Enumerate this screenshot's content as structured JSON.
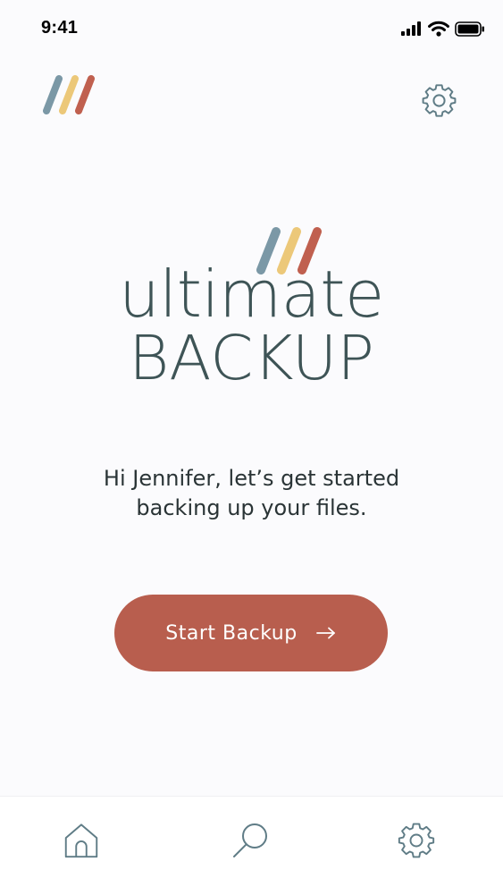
{
  "status_bar": {
    "time": "9:41",
    "icons": [
      "cellular-signal-icon",
      "wifi-icon",
      "battery-icon"
    ]
  },
  "header": {
    "logo": "app-logo-stripes",
    "settings_icon": "gear-icon"
  },
  "brand": {
    "word1": "ultimate",
    "word2": "BACKUP",
    "stripe_colors": [
      "#7b98a6",
      "#ecc879",
      "#c0604f"
    ]
  },
  "greeting": {
    "line1": "Hi Jennifer, let’s get started",
    "line2": "backing up your files."
  },
  "start_button": {
    "label": "Start Backup",
    "icon": "arrow-right-icon",
    "color": "#b85e4e"
  },
  "tab_bar": {
    "tabs": [
      {
        "name": "home",
        "icon": "home-icon"
      },
      {
        "name": "search",
        "icon": "search-icon"
      },
      {
        "name": "settings",
        "icon": "gear-icon"
      }
    ]
  },
  "colors": {
    "background": "#fbfbfd",
    "text_dark": "#3e5456",
    "icon_stroke": "#5f7c86"
  }
}
